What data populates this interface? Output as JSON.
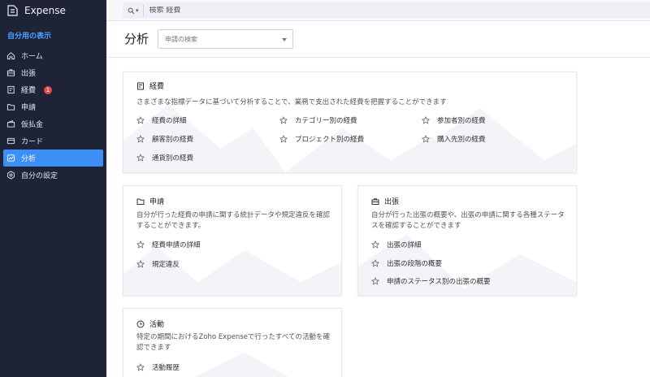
{
  "app": {
    "name": "Expense"
  },
  "sidebar": {
    "section_label": "自分用の表示",
    "items": [
      {
        "label": "ホーム",
        "icon": "home-icon"
      },
      {
        "label": "出張",
        "icon": "briefcase-icon"
      },
      {
        "label": "経費",
        "icon": "receipt-icon",
        "badge": "1"
      },
      {
        "label": "申請",
        "icon": "folder-icon"
      },
      {
        "label": "仮払金",
        "icon": "wallet-icon"
      },
      {
        "label": "カード",
        "icon": "card-icon"
      },
      {
        "label": "分析",
        "icon": "analytics-icon",
        "active": true
      },
      {
        "label": "自分の設定",
        "icon": "settings-icon"
      }
    ]
  },
  "search": {
    "placeholder": "検索 経費"
  },
  "header": {
    "title": "分析",
    "select_placeholder": "申請の検索"
  },
  "cards": {
    "expense": {
      "title": "経費",
      "desc": "さまざまな指標データに基づいて分析することで、業務で支出された経費を把握することができます",
      "links": [
        "経費の詳細",
        "カテゴリー別の経費",
        "参加者別の経費",
        "顧客別の経費",
        "プロジェクト別の経費",
        "購入先別の経費",
        "通貨別の経費"
      ]
    },
    "report": {
      "title": "申請",
      "desc_line1": "自分が行った経費の申請に関する統計データや規定違反を確認",
      "desc_line2": "することができます。",
      "links": [
        "経費申請の詳細",
        "規定違反"
      ]
    },
    "trip": {
      "title": "出張",
      "desc_line1": "自分が行った出張の概要や、出張の申請に関する各種ステータ",
      "desc_line2": "スを確認することができます",
      "links": [
        "出張の詳細",
        "出張の段階の概要",
        "申請のステータス別の出張の概要"
      ]
    },
    "activity": {
      "title": "活動",
      "desc_line1": "特定の期間におけるZoho Expenseで行ったすべての活動を確",
      "desc_line2": "認できます",
      "links": [
        "活動履歴"
      ]
    }
  },
  "colors": {
    "sidebar_bg": "#1e2338",
    "accent": "#3b8ff5",
    "section_label": "#4aa3ff",
    "badge": "#e5484d"
  }
}
